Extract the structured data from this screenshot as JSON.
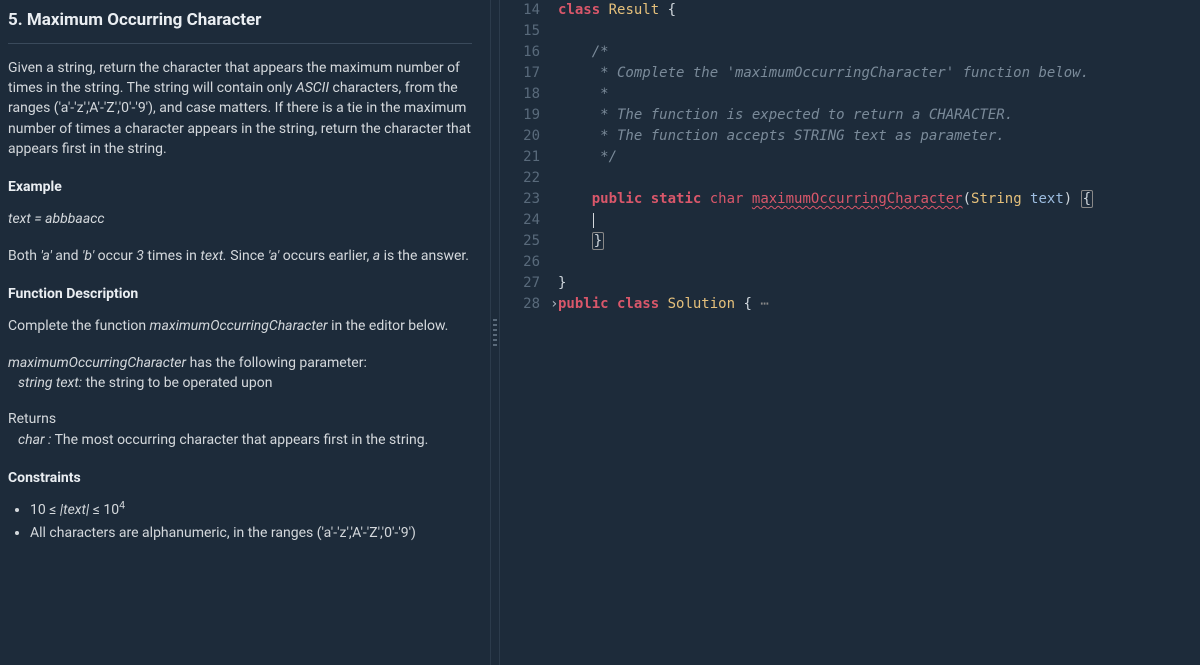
{
  "problem": {
    "title": "5. Maximum Occurring Character",
    "description_parts": {
      "p1a": "Given a string, return the character that appears the maximum number of times in the string. The string will contain only ",
      "p1_italic": "ASCII",
      "p1b": " characters, from the ranges ('a'-'z','A'-'Z','0'-'9'), and case matters. If there is a tie in the maximum number of times a character appears in the string, return the character that appears first in the string."
    },
    "example_head": "Example",
    "example_text": "text = abbbaacc",
    "example_expl": {
      "a": "Both ",
      "b": "'a'",
      "c": " and ",
      "d": "'b'",
      "e": " occur ",
      "f": "3",
      "g": " times in ",
      "h": "text.",
      "i": "  Since ",
      "j": "'a'",
      "k": " occurs earlier, ",
      "l": "a",
      "m": " is the answer."
    },
    "fn_desc_head": "Function Description",
    "fn_desc": {
      "a": "Complete the function ",
      "b": "maximumOccurringCharacter",
      "c": " in the editor below."
    },
    "param_line": {
      "a": "maximumOccurringCharacter",
      "b": " has the following parameter:"
    },
    "param_item": {
      "a": "string text:",
      "b": "  the string to be operated upon"
    },
    "returns_head": "Returns",
    "returns_item": {
      "a": "char :",
      "b": " The most occurring character that appears first in the string."
    },
    "constraints_head": "Constraints",
    "constraints": {
      "c1a": "10 ≤ ",
      "c1b": "|text|",
      "c1c": " ≤ 10",
      "c1sup": "4",
      "c2": "All characters are alphanumeric, in the ranges ('a'-'z','A'-'Z','0'-'9')"
    }
  },
  "editor": {
    "gutter": [
      "14",
      "15",
      "16",
      "17",
      "18",
      "19",
      "20",
      "21",
      "22",
      "23",
      "24",
      "25",
      "26",
      "27",
      "28"
    ],
    "lines": {
      "l14": {
        "kw": "class",
        "name": " Result ",
        "brace": "{"
      },
      "l16": "    /*",
      "l17a": "     * Complete the ",
      "l17b": "'maximumOccurringCharacter'",
      "l17c": " function below.",
      "l18": "     *",
      "l19": "     * The function is expected to return a CHARACTER.",
      "l20": "     * The function accepts STRING text as parameter.",
      "l21": "     */",
      "l23": {
        "pub": "public",
        "stat": " static",
        "ch": " char ",
        "fn": "maximumOccurringCharacter",
        "paren": "(",
        "ptype": "String",
        "pname": " text",
        "rparen": ") ",
        "brace": "{"
      },
      "l25_brace": "}",
      "l27": "}",
      "l28": {
        "pub": "public",
        "cls": " class",
        "name": " Solution ",
        "brace": "{",
        "dots": " ⋯"
      }
    }
  }
}
